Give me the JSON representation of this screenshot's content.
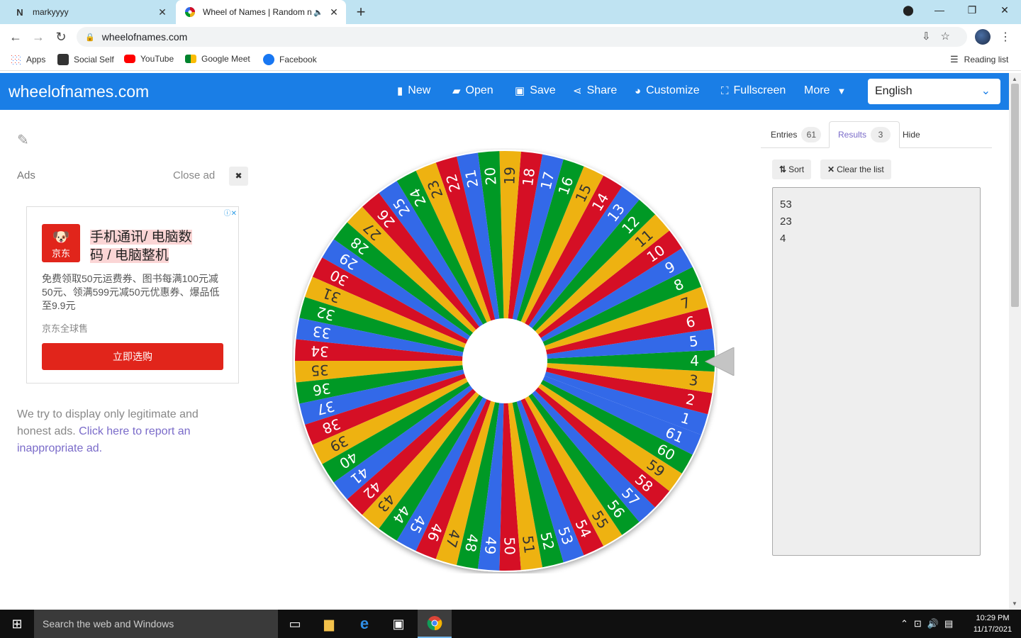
{
  "browser": {
    "tabs": [
      {
        "title": "markyyyy",
        "icon": "notion-icon"
      },
      {
        "title": "Wheel of Names | Random n",
        "icon": "wheelofnames-icon",
        "active": true
      }
    ],
    "url": "wheelofnames.com",
    "bookmarks": [
      {
        "label": "Apps",
        "icon": "apps-grid-icon"
      },
      {
        "label": "Social Self",
        "icon": "person-icon"
      },
      {
        "label": "YouTube",
        "icon": "youtube-icon"
      },
      {
        "label": "Google Meet",
        "icon": "google-meet-icon"
      },
      {
        "label": "Facebook",
        "icon": "facebook-icon"
      }
    ],
    "reading_list": "Reading list"
  },
  "app": {
    "brand": "wheelofnames.com",
    "menu": {
      "new": "New",
      "open": "Open",
      "save": "Save",
      "share": "Share",
      "customize": "Customize",
      "fullscreen": "Fullscreen",
      "more": "More"
    },
    "language": "English",
    "accent": "#1a7ee6"
  },
  "ads": {
    "label": "Ads",
    "close_label": "Close ad",
    "logo_text": "京东",
    "title_line1": "手机通讯/ 电脑数",
    "title_line2": "码 / 电脑整机",
    "body": "免费领取50元运费券、图书每满100元减50元、领满599元减50元优惠券、爆品低至9.9元",
    "seller": "京东全球售",
    "cta": "立即选购",
    "note_text": "We try to display only legitimate and honest ads. ",
    "note_link": "Click here to report an inappropriate ad."
  },
  "wheel": {
    "labels": [
      "1",
      "2",
      "3",
      "4",
      "5",
      "6",
      "7",
      "8",
      "9",
      "10",
      "11",
      "12",
      "13",
      "14",
      "15",
      "16",
      "17",
      "18",
      "19",
      "20",
      "21",
      "22",
      "23",
      "24",
      "25",
      "26",
      "27",
      "28",
      "29",
      "30",
      "31",
      "32",
      "33",
      "34",
      "35",
      "36",
      "37",
      "38",
      "39",
      "40",
      "41",
      "42",
      "43",
      "44",
      "45",
      "46",
      "47",
      "48",
      "49",
      "50",
      "51",
      "52",
      "53",
      "54",
      "55",
      "56",
      "57",
      "58",
      "59",
      "60",
      "61"
    ],
    "colors": [
      "#3369e8",
      "#d50f25",
      "#eeb211",
      "#009925"
    ]
  },
  "panel": {
    "tab_entries": "Entries",
    "entries_count": "61",
    "tab_results": "Results",
    "results_count": "3",
    "tab_hide": "Hide",
    "sort": "Sort",
    "clear": "Clear the list",
    "results": [
      "53",
      "23",
      "4"
    ]
  },
  "taskbar": {
    "search_placeholder": "Search the web and Windows",
    "time": "10:29 PM",
    "date": "11/17/2021"
  }
}
